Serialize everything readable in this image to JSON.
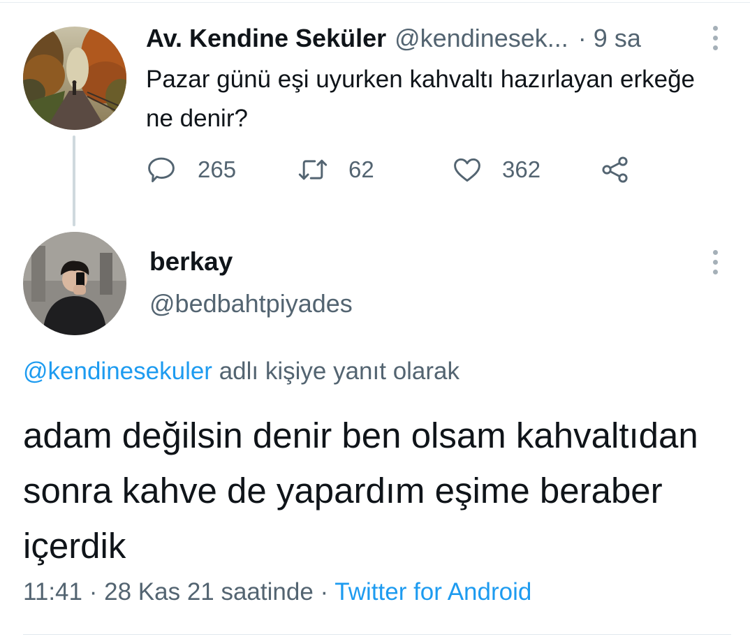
{
  "parent_tweet": {
    "display_name": "Av. Kendine Seküler",
    "handle": "@kendinesek...",
    "time_separator": "·",
    "relative_time": "9 sa",
    "text": "Pazar günü eşi uyurken kahvaltı hazırlayan erkeğe ne denir?",
    "reply_count": "265",
    "retweet_count": "62",
    "like_count": "362"
  },
  "reply_tweet": {
    "display_name": "berkay",
    "handle": "@bedbahtpiyades",
    "replying_to_handle": "@kendinesekuler",
    "replying_to_suffix": " adlı kişiye yanıt olarak",
    "text": "adam değilsin denir ben olsam kahvaltıdan sonra kahve de yapardım eşime beraber içerdik",
    "time": "11:41",
    "date": "28 Kas 21 saatinde",
    "separator": "·",
    "source": "Twitter for Android"
  },
  "icons": {
    "more": "more-vertical-icon",
    "reply": "speech-bubble-icon",
    "retweet": "retweet-icon",
    "like": "heart-icon",
    "share": "share-nodes-icon"
  },
  "colors": {
    "text_primary": "#0f1419",
    "text_secondary": "#536471",
    "link": "#1d9bf0",
    "thread_line": "#cfd9de"
  }
}
